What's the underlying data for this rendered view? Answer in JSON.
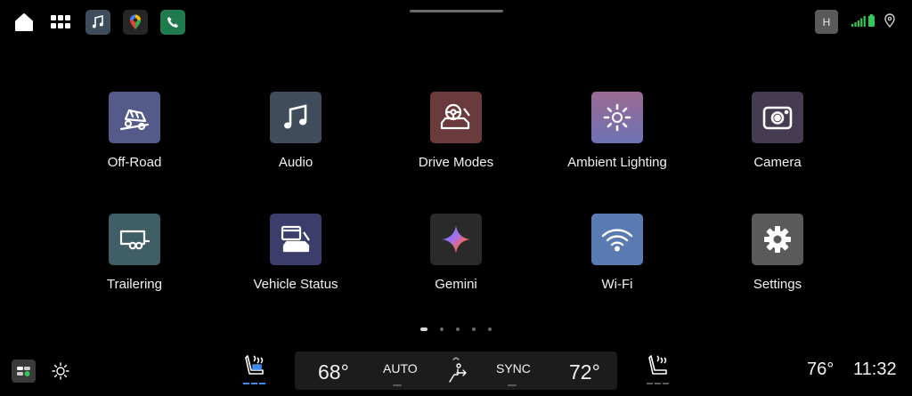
{
  "status_bar": {
    "profile_initial": "H",
    "signal_color": "#34c759",
    "battery_color": "#34c759"
  },
  "icons": {
    "home": "home-icon",
    "app_grid": "app-grid-icon",
    "music": "music-icon",
    "maps": "maps-icon",
    "phone": "phone-icon",
    "location": "location-pin-icon"
  },
  "apps": [
    {
      "label": "Off-Road",
      "color": "#545a8a"
    },
    {
      "label": "Audio",
      "color": "#3e4c5c"
    },
    {
      "label": "Drive Modes",
      "color": "#6a3a3c"
    },
    {
      "label": "Ambient Lighting",
      "color": "#8a6aa0"
    },
    {
      "label": "Camera",
      "color": "#463c52"
    },
    {
      "label": "Trailering",
      "color": "#3f5e66"
    },
    {
      "label": "Vehicle Status",
      "color": "#3c3d6a"
    },
    {
      "label": "Gemini",
      "color": "#2a2a2a"
    },
    {
      "label": "Wi-Fi",
      "color": "#5a7ab2"
    },
    {
      "label": "Settings",
      "color": "#5a5a5a"
    }
  ],
  "pagination": {
    "pages": 5,
    "current": 1
  },
  "climate": {
    "driver_temp": "68°",
    "auto_label": "AUTO",
    "sync_label": "SYNC",
    "passenger_temp": "72°"
  },
  "outside_temp": "76°",
  "clock": "11:32"
}
